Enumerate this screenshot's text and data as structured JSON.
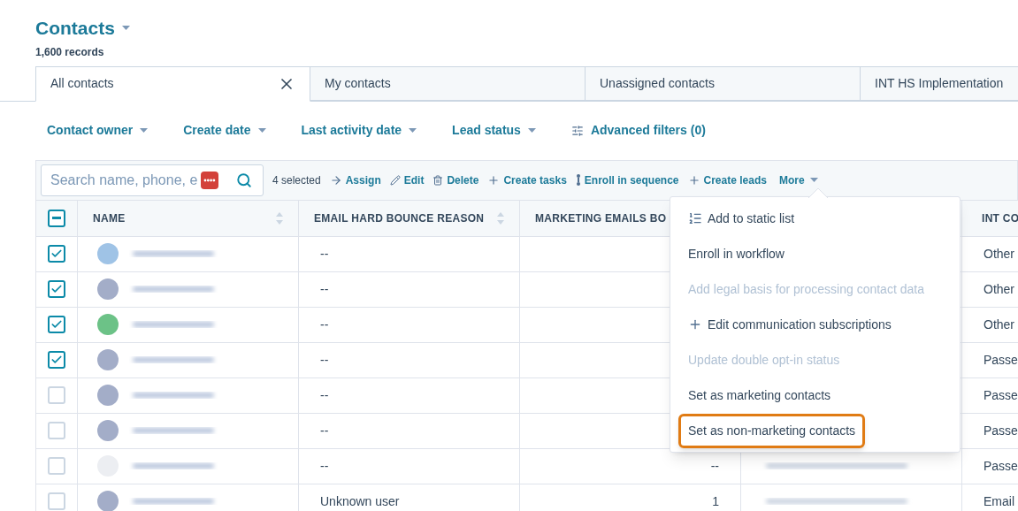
{
  "header": {
    "title": "Contacts",
    "subtitle": "1,600 records"
  },
  "tabs": [
    {
      "label": "All contacts",
      "selected": true
    },
    {
      "label": "My contacts",
      "selected": false
    },
    {
      "label": "Unassigned contacts",
      "selected": false
    },
    {
      "label": "INT HS Implementation",
      "selected": false
    }
  ],
  "filters": [
    {
      "label": "Contact owner",
      "kind": "dropdown"
    },
    {
      "label": "Create date",
      "kind": "dropdown"
    },
    {
      "label": "Last activity date",
      "kind": "dropdown"
    },
    {
      "label": "Lead status",
      "kind": "dropdown"
    },
    {
      "label": "Advanced filters (0)",
      "kind": "advanced"
    }
  ],
  "toolbar": {
    "search": {
      "placeholder": "Search name, phone, e"
    },
    "selected_count": "4 selected",
    "actions": [
      {
        "label": "Assign",
        "kind": "assign"
      },
      {
        "label": "Edit",
        "kind": "edit"
      },
      {
        "label": "Delete",
        "kind": "delete"
      },
      {
        "label": "Create tasks",
        "kind": "plus"
      },
      {
        "label": "Enroll in sequence",
        "kind": "sequence"
      },
      {
        "label": "Create leads",
        "kind": "plus"
      },
      {
        "label": "More",
        "kind": "more"
      }
    ]
  },
  "table": {
    "select_all": {
      "indeterminate": true
    },
    "columns": [
      "NAME",
      "EMAIL HARD BOUNCE REASON",
      "MARKETING EMAILS BO",
      "INT CO"
    ],
    "rows": [
      {
        "checked": true,
        "color": "#9fc3e6",
        "bounce_reason": "--",
        "int_co": "Other"
      },
      {
        "checked": true,
        "color": "#a3adc8",
        "bounce_reason": "--",
        "int_co": "Other"
      },
      {
        "checked": true,
        "color": "#6cc287",
        "bounce_reason": "--",
        "int_co": "Other"
      },
      {
        "checked": true,
        "color": "#a3adc8",
        "bounce_reason": "--",
        "int_co": "Passe"
      },
      {
        "checked": false,
        "color": "#a3adc8",
        "bounce_reason": "--",
        "int_co": "Passe"
      },
      {
        "checked": false,
        "color": "#a3adc8",
        "bounce_reason": "--",
        "int_co": "Passe"
      },
      {
        "checked": false,
        "color": "#eceef2",
        "bounce_reason": "--",
        "marketing_emails": "--",
        "int_co": "Passe",
        "company_blurred": true
      },
      {
        "checked": false,
        "color": "#a3adc8",
        "bounce_reason": "Unknown user",
        "marketing_emails": "1",
        "int_co": "Email",
        "company_blurred": true
      }
    ]
  },
  "more_menu": {
    "items": [
      {
        "label": "Add to static list",
        "kind": "list",
        "disabled": false,
        "highlighted": false
      },
      {
        "label": "Enroll in workflow",
        "kind": "plain",
        "disabled": false,
        "highlighted": false
      },
      {
        "label": "Add legal basis for processing contact data",
        "kind": "plain",
        "disabled": true,
        "highlighted": false
      },
      {
        "label": "Edit communication subscriptions",
        "kind": "plus",
        "disabled": false,
        "highlighted": false
      },
      {
        "label": "Update double opt-in status",
        "kind": "plain",
        "disabled": true,
        "highlighted": false
      },
      {
        "label": "Set as marketing contacts",
        "kind": "plain",
        "disabled": false,
        "highlighted": false
      },
      {
        "label": "Set as non-marketing contacts",
        "kind": "plain",
        "disabled": false,
        "highlighted": true
      }
    ]
  }
}
